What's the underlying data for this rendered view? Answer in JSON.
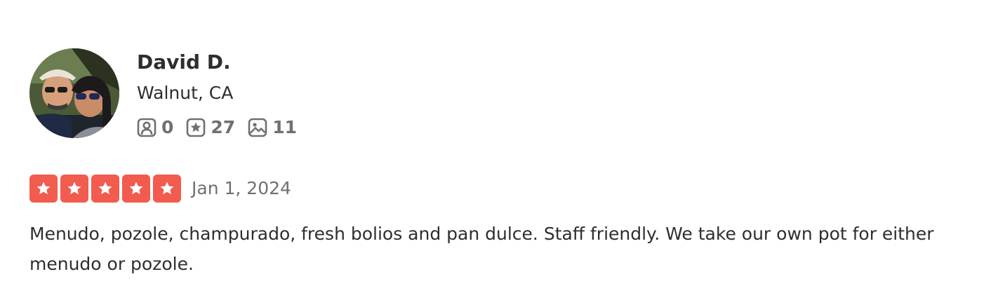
{
  "user": {
    "name": "David D.",
    "location": "Walnut, CA",
    "stats": {
      "friends": "0",
      "reviews": "27",
      "photos": "11"
    }
  },
  "review": {
    "rating": 5,
    "max_rating": 5,
    "date": "Jan 1, 2024",
    "text": "Menudo, pozole, champurado, fresh bolios and pan dulce. Staff friendly. We take our own pot for either menudo or pozole."
  },
  "colors": {
    "star_fill": "#f15c4f",
    "text_primary": "#2d2e2f",
    "text_secondary": "#6e7072"
  },
  "icons": {
    "friends": "friends-icon",
    "reviews": "review-star-icon",
    "photos": "photo-icon"
  }
}
